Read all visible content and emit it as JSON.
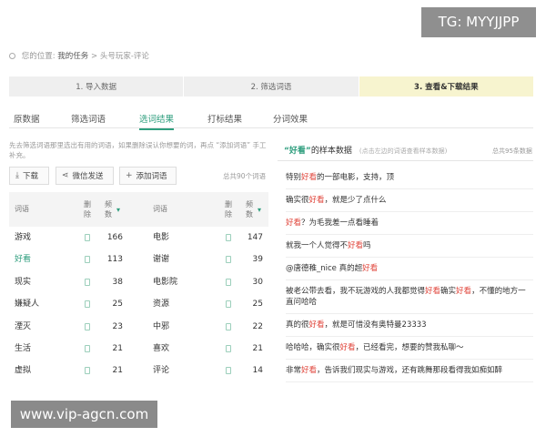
{
  "watermarks": {
    "top": "TG: MYYJJPP",
    "bottom": "www.vip-agcn.com"
  },
  "breadcrumb": {
    "prefix": "您的位置:",
    "current": "我的任务",
    "separator": ">",
    "path": "头号玩家-评论"
  },
  "steps": [
    "1. 导入数据",
    "2. 筛选词语",
    "3. 查看&下载结果"
  ],
  "tabs": [
    "原数据",
    "筛选词语",
    "选词结果",
    "打标结果",
    "分词效果"
  ],
  "tip": "先去筛选词语那里选出有用的词语，如果删除误认你想要的词，再点 “添加词语” 手工补充。",
  "buttons": {
    "download": "下载",
    "wechat": "微信发送",
    "add": "添加词语"
  },
  "total_left": "总共90个词语",
  "table": {
    "headers": {
      "word": "词语",
      "delete": "删除",
      "freq": "频数"
    },
    "rows": [
      [
        "游戏",
        "166",
        "电影",
        "147"
      ],
      [
        "好看",
        "113",
        "谢谢",
        "39"
      ],
      [
        "现实",
        "38",
        "电影院",
        "30"
      ],
      [
        "嫌疑人",
        "25",
        "资源",
        "25"
      ],
      [
        "湮灭",
        "23",
        "中邪",
        "22"
      ],
      [
        "生活",
        "21",
        "喜欢",
        "21"
      ],
      [
        "虚拟",
        "21",
        "评论",
        "14"
      ]
    ]
  },
  "right": {
    "title_quote": "“好看”",
    "title_rest": "的样本数据",
    "hint": "(点击左边的词语查看样本数据)",
    "total": "总共95条数据"
  },
  "keyword": "好看",
  "samples": [
    [
      "特别",
      "好看",
      "的一部电影，支持，顶"
    ],
    [
      "确实很",
      "好看",
      "，就是少了点什么"
    ],
    [
      "",
      "好看",
      "？为毛我差一点看睡着"
    ],
    [
      "就我一个人觉得不",
      "好看",
      "吗"
    ],
    [
      "@唐德稚_nice 真的超",
      "好看",
      ""
    ],
    [
      "被老公带去看，我不玩游戏的人我都觉得",
      "好看",
      "确实",
      "好看",
      "，不懂的地方一直问哈哈"
    ],
    [
      "真的很",
      "好看",
      "，就是可惜没有奥特曼23333"
    ],
    [
      "哈哈哈，确实很",
      "好看",
      "，已经看完，想要的赞我私聊～"
    ],
    [
      "非常",
      "好看",
      "，告诉我们现实与游戏，还有跳舞那段看得我如痴如醉"
    ]
  ],
  "colors": {
    "accent": "#2f9e7e",
    "keyword": "#e0453b",
    "active_step": "#f7f4cf"
  }
}
